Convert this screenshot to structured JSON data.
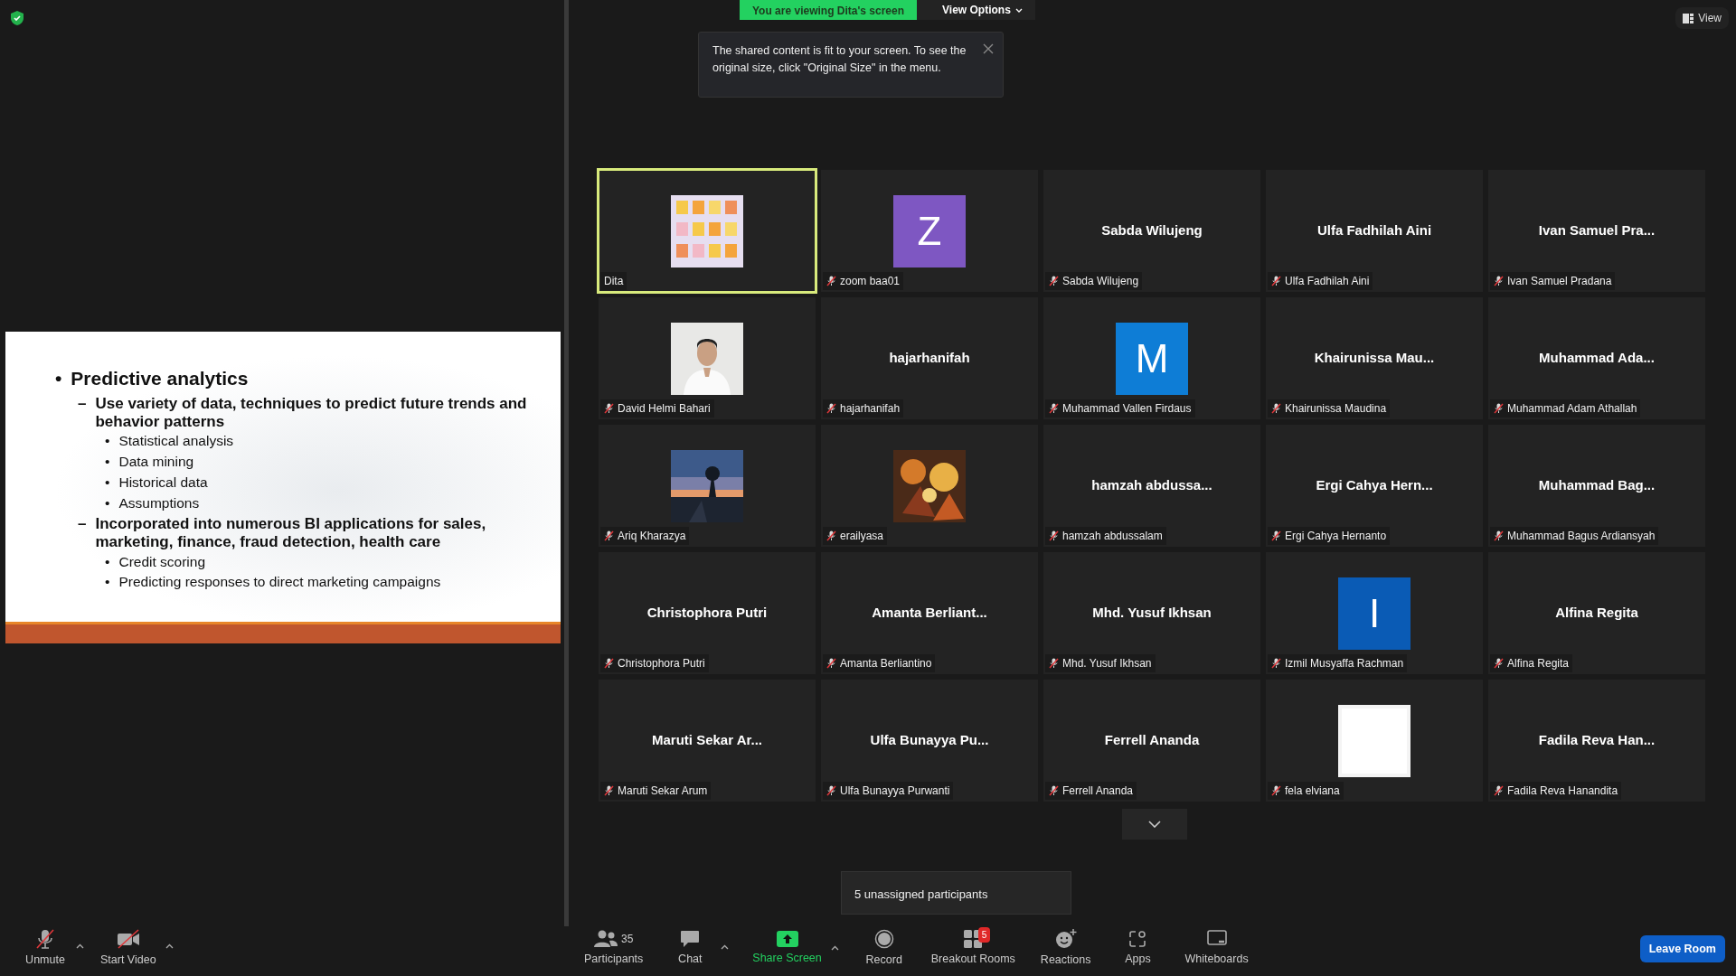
{
  "share_banner": {
    "text": "You are viewing Dita's screen",
    "view_options": "View Options"
  },
  "tooltip": {
    "text": "The shared content is fit to your screen. To see the original size, click \"Original Size\" in the menu."
  },
  "view_button": "View",
  "slide": {
    "items": [
      {
        "marker": "•",
        "text": "Predictive analytics",
        "children": [
          {
            "marker": "–",
            "text": "Use variety of data, techniques to predict future trends and behavior patterns",
            "children": [
              {
                "marker": "•",
                "text": "Statistical analysis"
              },
              {
                "marker": "•",
                "text": "Data mining"
              },
              {
                "marker": "•",
                "text": "Historical data"
              },
              {
                "marker": "•",
                "text": "Assumptions"
              }
            ]
          },
          {
            "marker": "–",
            "text": "Incorporated into numerous BI applications for sales, marketing, finance, fraud detection, health care",
            "children": [
              {
                "marker": "•",
                "text": "Credit scoring"
              },
              {
                "marker": "•",
                "text": "Predicting responses to direct marketing campaigns"
              }
            ]
          }
        ]
      }
    ]
  },
  "tiles": [
    {
      "kind": "picture",
      "label": "Dita",
      "muted": false,
      "selected": true
    },
    {
      "kind": "avatar",
      "letter": "Z",
      "color": "#7e57c2",
      "label": "zoom baa01",
      "muted": true,
      "selected": false
    },
    {
      "kind": "name",
      "display_name": "Sabda Wilujeng",
      "label": "Sabda Wilujeng",
      "muted": true,
      "selected": false
    },
    {
      "kind": "name",
      "display_name": "Ulfa Fadhilah Aini",
      "label": "Ulfa Fadhilah Aini",
      "muted": true,
      "selected": false
    },
    {
      "kind": "name",
      "display_name": "Ivan Samuel Pra...",
      "label": "Ivan Samuel Pradana",
      "muted": true,
      "selected": false
    },
    {
      "kind": "picture",
      "label": "David Helmi Bahari",
      "muted": true,
      "selected": false
    },
    {
      "kind": "name",
      "display_name": "hajarhanifah",
      "label": "hajarhanifah",
      "muted": true,
      "selected": false
    },
    {
      "kind": "avatar",
      "letter": "M",
      "color": "#0e7dd6",
      "label": "Muhammad Vallen Firdaus",
      "muted": true,
      "selected": false
    },
    {
      "kind": "name",
      "display_name": "Khairunissa Mau...",
      "label": "Khairunissa Maudina",
      "muted": true,
      "selected": false
    },
    {
      "kind": "name",
      "display_name": "Muhammad Ada...",
      "label": "Muhammad Adam Athallah",
      "muted": true,
      "selected": false
    },
    {
      "kind": "picture",
      "label": "Ariq Kharazya",
      "muted": true,
      "selected": false
    },
    {
      "kind": "picture",
      "label": "erailyasa",
      "muted": true,
      "selected": false
    },
    {
      "kind": "name",
      "display_name": "hamzah abdussa...",
      "label": "hamzah abdussalam",
      "muted": true,
      "selected": false
    },
    {
      "kind": "name",
      "display_name": "Ergi Cahya Hern...",
      "label": "Ergi Cahya Hernanto",
      "muted": true,
      "selected": false
    },
    {
      "kind": "name",
      "display_name": "Muhammad Bag...",
      "label": "Muhammad Bagus Ardiansyah",
      "muted": true,
      "selected": false
    },
    {
      "kind": "name",
      "display_name": "Christophora Putri",
      "label": "Christophora Putri",
      "muted": true,
      "selected": false
    },
    {
      "kind": "name",
      "display_name": "Amanta Berliant...",
      "label": "Amanta Berliantino",
      "muted": true,
      "selected": false
    },
    {
      "kind": "name",
      "display_name": "Mhd. Yusuf Ikhsan",
      "label": "Mhd. Yusuf Ikhsan",
      "muted": true,
      "selected": false
    },
    {
      "kind": "avatar",
      "letter": "I",
      "color": "#0a5bb5",
      "label": "Izmil Musyaffa Rachman",
      "muted": true,
      "selected": false
    },
    {
      "kind": "name",
      "display_name": "Alfina Regita",
      "label": "Alfina Regita",
      "muted": true,
      "selected": false
    },
    {
      "kind": "name",
      "display_name": "Maruti Sekar Ar...",
      "label": "Maruti Sekar Arum",
      "muted": true,
      "selected": false
    },
    {
      "kind": "name",
      "display_name": "Ulfa Bunayya Pu...",
      "label": "Ulfa Bunayya Purwanti",
      "muted": true,
      "selected": false
    },
    {
      "kind": "name",
      "display_name": "Ferrell Ananda",
      "label": "Ferrell Ananda",
      "muted": true,
      "selected": false
    },
    {
      "kind": "picture",
      "label": "fela elviana",
      "muted": true,
      "selected": false
    },
    {
      "kind": "name",
      "display_name": "Fadila Reva Han...",
      "label": "Fadila Reva Hanandita",
      "muted": true,
      "selected": false
    }
  ],
  "unassigned_popup": "5 unassigned participants",
  "toolbar_left": [
    {
      "label": "Unmute",
      "menu": true
    },
    {
      "label": "Start Video",
      "menu": true
    }
  ],
  "toolbar_center": [
    {
      "label": "Participants",
      "count": "35",
      "menu": false,
      "highlight": false
    },
    {
      "label": "Chat",
      "menu": true,
      "highlight": false
    },
    {
      "label": "Share Screen",
      "menu": true,
      "highlight": true
    },
    {
      "label": "Record",
      "menu": false,
      "highlight": false
    },
    {
      "label": "Breakout Rooms",
      "badge": "5",
      "menu": false,
      "highlight": false
    },
    {
      "label": "Reactions",
      "menu": false,
      "highlight": false
    },
    {
      "label": "Apps",
      "menu": false,
      "highlight": false
    },
    {
      "label": "Whiteboards",
      "menu": false,
      "highlight": false
    }
  ],
  "leave_button": "Leave Room"
}
